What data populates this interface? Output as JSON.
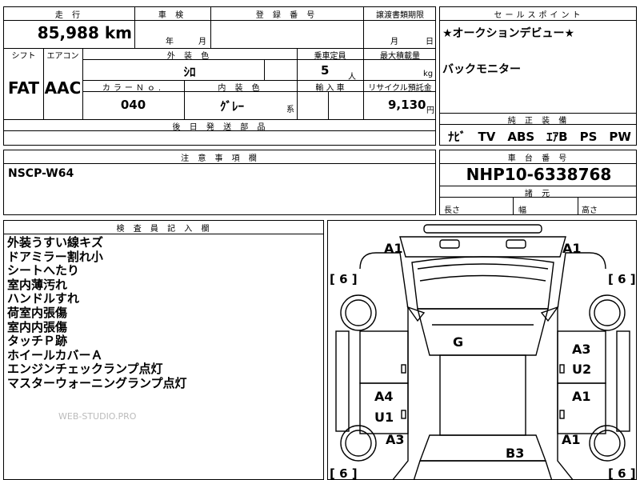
{
  "row1": {
    "mileage_label": "走 行",
    "inspection_label": "車 検",
    "registration_label": "登 録 番 号",
    "transfer_label": "譲渡書類期限",
    "mileage_value": "85,988",
    "mileage_unit": "km",
    "year_unit": "年",
    "month_unit": "月",
    "transfer_month": "月",
    "transfer_day": "日"
  },
  "row2": {
    "shift_label": "シフト",
    "aircon_label": "エアコン",
    "exterior_label": "外 装 色",
    "capacity_label": "乗車定員",
    "maxload_label": "最大積載量",
    "shift_value": "FAT",
    "aircon_value": "AAC",
    "exterior_value": "ｼﾛ",
    "capacity_value": "5",
    "capacity_unit": "人",
    "load_unit": "kg",
    "color_no_label": "カラーＮｏ.",
    "interior_label": "内 装 色",
    "import_label": "輸 入 車",
    "recycle_label": "リサイクル預託金",
    "color_no_value": "040",
    "interior_value": "ｸﾞﾚｰ",
    "interior_suffix": "系",
    "recycle_value": "9,130",
    "recycle_unit": "円",
    "later_parts_label": "後 日 発 送 部 品"
  },
  "sales": {
    "label": "セールスポイント",
    "line1": "★オークションデビュー★",
    "line2": "バックモニター",
    "equipment_label": "純 正 装 備",
    "equipment": "ﾅﾋﾞ　TV　ABS　ｴｱB　PS　PW"
  },
  "notes": {
    "label": "注 意 事 項 欄",
    "value": "NSCP-W64"
  },
  "chassis": {
    "label": "車 台 番 号",
    "value": "NHP10-6338768",
    "dims_label": "諸 元",
    "length_label": "長さ",
    "width_label": "幅",
    "height_label": "高さ"
  },
  "inspector": {
    "label": "検 査 員 記 入 欄",
    "lines": [
      "外装うすい線キズ",
      "ドアミラー割れ小",
      "シートへたり",
      "室内薄汚れ",
      "ハンドルすれ",
      "荷室内張傷",
      "室内内張傷",
      "タッチＰ跡",
      "ホイールカバーＡ",
      "エンジンチェックランプ点灯",
      "マスターウォーニングランプ点灯"
    ]
  },
  "diagram": {
    "marks": {
      "front_left": "A1",
      "front_right": "A1",
      "roof": "G",
      "right_front_door": "A3",
      "right_front_door2": "U2",
      "left_rear_door": "A4",
      "left_rear_door2": "U1",
      "right_rear_door": "A1",
      "left_rear_fender": "A3",
      "right_rear_fender": "A1",
      "rear": "B3"
    },
    "brackets": {
      "fl": "[ 6 ]",
      "fr": "[ 6 ]",
      "rl": "[ 6 ]",
      "rr": "[ 6 ]"
    }
  },
  "watermark": "WEB-STUDIO.PRO"
}
